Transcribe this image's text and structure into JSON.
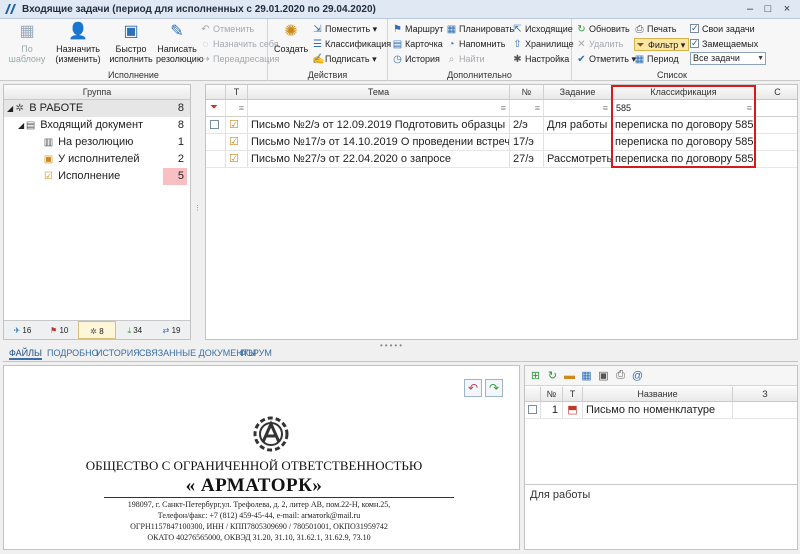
{
  "window": {
    "title": "Входящие задачи (период для исполненных с 29.01.2020 по 29.04.2020)",
    "controls": [
      "–",
      "□",
      "×"
    ]
  },
  "ribbon": {
    "execution": {
      "label": "Исполнение",
      "by_template": "По шаблону",
      "assign": "Назначить (изменить)",
      "quick_executors": "Быстро исполнить",
      "write_resolution": "Написать резолюцию",
      "cancel": "Отменить",
      "assign_self": "Назначить себя",
      "redirect": "Переадресация"
    },
    "actions": {
      "label": "Действия",
      "create": "Создать",
      "place": "Поместить",
      "classification": "Классификация",
      "sign": "Подписать"
    },
    "additional": {
      "label": "Дополнительно",
      "route": "Маршрут",
      "card": "Карточка",
      "history": "История",
      "plan": "Планировать",
      "remind": "Напомнить",
      "find": "Найти",
      "outgoing": "Исходящие",
      "storage": "Хранилище",
      "settings": "Настройка"
    },
    "list": {
      "label": "Список",
      "refresh": "Обновить",
      "delete": "Удалить",
      "mark": "Отметить",
      "print": "Печать",
      "filter": "Фильтр",
      "period": "Период",
      "own_tasks": "Свои задачи",
      "substituted": "Замещаемых",
      "task_filter": "Все задачи"
    }
  },
  "group_panel": {
    "header": "Группа",
    "items": [
      {
        "label": "В РАБОТЕ",
        "count": "8"
      },
      {
        "label": "Входящий документ",
        "count": "8"
      },
      {
        "label": "На резолюцию",
        "count": "1"
      },
      {
        "label": "У исполнителей",
        "count": "2"
      },
      {
        "label": "Исполнение",
        "count": "5"
      }
    ],
    "footer": [
      "16",
      "10",
      "8",
      "34",
      "19"
    ]
  },
  "grid": {
    "headers": {
      "t": "Т",
      "topic": "Тема",
      "num": "№",
      "task": "Задание",
      "class": "Классификация",
      "extra": "С"
    },
    "filter_class": "585",
    "rows": [
      {
        "topic": "Письмо №2/э от 12.09.2019 Подготовить образцы",
        "num": "2/э",
        "task": "Для работы",
        "class": "переписка по договору 585"
      },
      {
        "topic": "Письмо №17/э от 14.10.2019 О проведении встречи",
        "num": "17/э",
        "task": "",
        "class": "переписка по договору 585"
      },
      {
        "topic": "Письмо №27/э от 22.04.2020 о запросе",
        "num": "27/э",
        "task": "Рассмотреть",
        "class": "переписка по договору 585"
      }
    ]
  },
  "tabs": [
    "ФАЙЛЫ",
    "ПОДРОБНО",
    "ИСТОРИЯ",
    "СВЯЗАННЫЕ ДОКУМЕНТЫ",
    "ФОРУМ"
  ],
  "document": {
    "org_line1": "ОБЩЕСТВО С ОГРАНИЧЕННОЙ ОТВЕТСТВЕННОСТЬЮ",
    "org_name": "« АРМАТОРК»",
    "address": "198097, г. Санкт-Петербург,ул. Трефолева, д. 2, литер АВ, пом.22-Н, комн.25,",
    "phone": "Телефон/факс: +7 (812) 459-45-44, e-mail: arматork@mail.ru",
    "ogrn": "ОГРН1157847100300, ИНН / КПП7805309690 / 780501001, ОКПО31959742",
    "okato": "ОКАТО 40276565000, ОКВЭД 31.20, 31.10, 31.62.1, 31.62.9, 73.10"
  },
  "attachments": {
    "headers": {
      "num": "№",
      "t": "Т",
      "name": "Название",
      "extra": "З"
    },
    "rows": [
      {
        "num": "1",
        "name": "Письмо по номенклатуре"
      }
    ],
    "note": "Для работы"
  }
}
